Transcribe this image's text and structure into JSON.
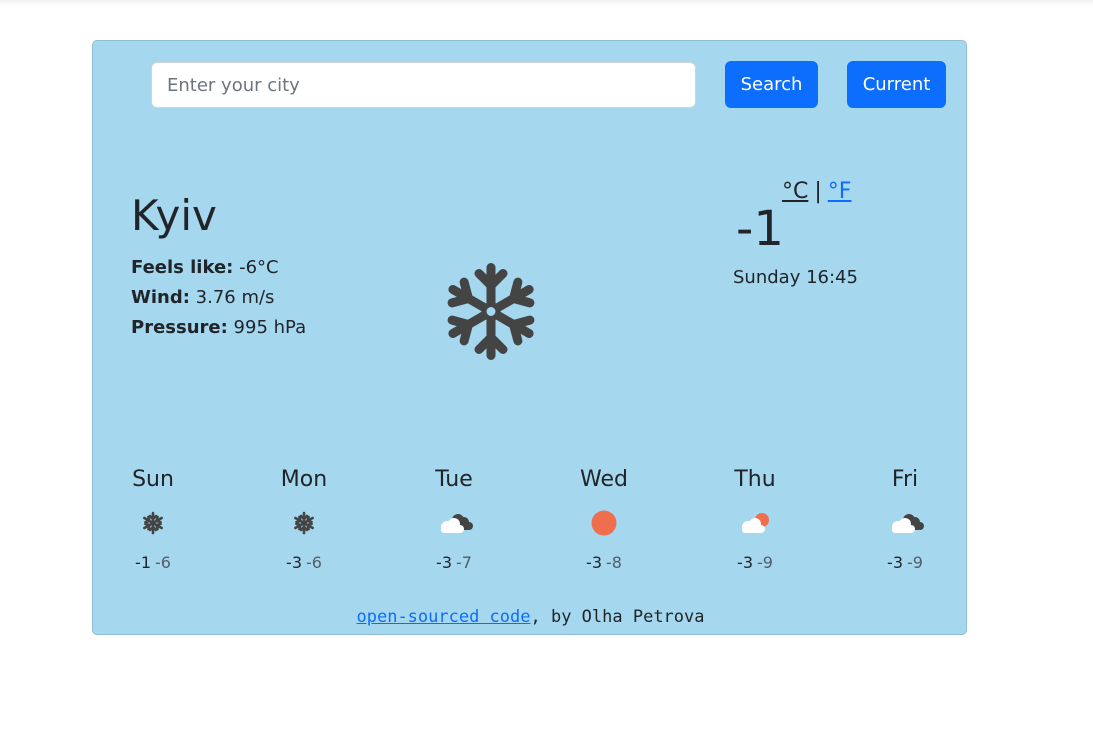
{
  "search": {
    "placeholder": "Enter your city",
    "value": "",
    "search_label": "Search",
    "current_label": "Current"
  },
  "weather": {
    "city": "Kyiv",
    "feels_like_label": "Feels like:",
    "feels_like_value": "-6°C",
    "wind_label": "Wind:",
    "wind_value": "3.76 m/s",
    "pressure_label": "Pressure:",
    "pressure_value": "995 hPa",
    "icon": "snowflake-icon",
    "temperature": "-1",
    "unit_celsius": "°C",
    "unit_separator": "|",
    "unit_fahrenheit": "°F",
    "datetime": "Sunday 16:45"
  },
  "forecast": [
    {
      "day": "Sun",
      "icon": "snowflake-icon",
      "hi": "-1",
      "lo": "-6"
    },
    {
      "day": "Mon",
      "icon": "snowflake-icon",
      "hi": "-3",
      "lo": "-6"
    },
    {
      "day": "Tue",
      "icon": "cloudy-icon",
      "hi": "-3",
      "lo": "-7"
    },
    {
      "day": "Wed",
      "icon": "sun-icon",
      "hi": "-3",
      "lo": "-8"
    },
    {
      "day": "Thu",
      "icon": "partly-cloudy-icon",
      "hi": "-3",
      "lo": "-9"
    },
    {
      "day": "Fri",
      "icon": "cloudy-icon",
      "hi": "-3",
      "lo": "-9"
    }
  ],
  "footer": {
    "link_text": "open-sourced code",
    "suffix": ", by Olha Petrova"
  },
  "colors": {
    "card_background": "#a5d7ee",
    "button": "#0d6efd",
    "link": "#0d6efd",
    "sun": "#ee6e4d",
    "cloud_dark": "#444444",
    "icon": "#444444"
  }
}
